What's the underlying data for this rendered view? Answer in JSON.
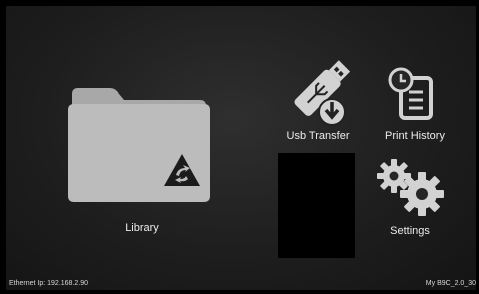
{
  "tiles": {
    "library": {
      "label": "Library",
      "icon": "folder-icon"
    },
    "usb_transfer": {
      "label": "Usb Transfer",
      "icon": "usb-download-icon"
    },
    "print_history": {
      "label": "Print History",
      "icon": "clock-document-icon"
    },
    "settings": {
      "label": "Settings",
      "icon": "gears-icon"
    }
  },
  "footer": {
    "ethernet_ip": "Ethernet Ip: 192.168.2.90",
    "device_name": "My B9C_2.0_30"
  },
  "colors": {
    "background": "#1e1e1e",
    "icon": "#d2d2d2",
    "text": "#ececec"
  }
}
